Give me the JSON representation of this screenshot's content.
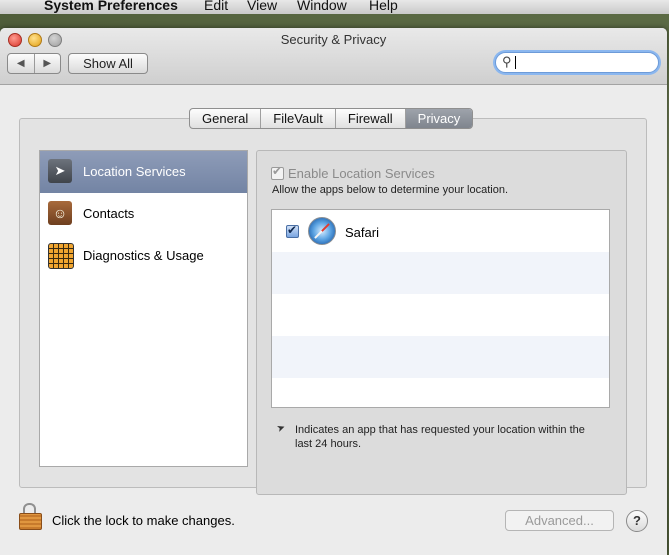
{
  "menubar": {
    "apple_icon": "apple-icon",
    "app_name": "System Preferences",
    "items": [
      "Edit",
      "View",
      "Window",
      "Help"
    ]
  },
  "window": {
    "title": "Security & Privacy",
    "show_all": "Show All",
    "search": {
      "value": "",
      "placeholder": ""
    }
  },
  "tabs": [
    {
      "label": "General",
      "selected": false
    },
    {
      "label": "FileVault",
      "selected": false
    },
    {
      "label": "Firewall",
      "selected": false
    },
    {
      "label": "Privacy",
      "selected": true
    }
  ],
  "sidebar": {
    "items": [
      {
        "label": "Location Services",
        "icon": "location-arrow-icon",
        "selected": true
      },
      {
        "label": "Contacts",
        "icon": "contacts-book-icon",
        "selected": false
      },
      {
        "label": "Diagnostics & Usage",
        "icon": "diagnostics-grid-icon",
        "selected": false
      }
    ]
  },
  "privacy": {
    "enable_label": "Enable Location Services",
    "enable_checked": true,
    "enable_disabled": true,
    "allow_text": "Allow the apps below to determine your location.",
    "apps": [
      {
        "name": "Safari",
        "icon": "safari-compass-icon",
        "checked": true
      }
    ],
    "note": "Indicates an app that has requested your location within the last 24 hours."
  },
  "footer": {
    "lock_text": "Click the lock to make changes.",
    "advanced_label": "Advanced...",
    "help_label": "?"
  }
}
